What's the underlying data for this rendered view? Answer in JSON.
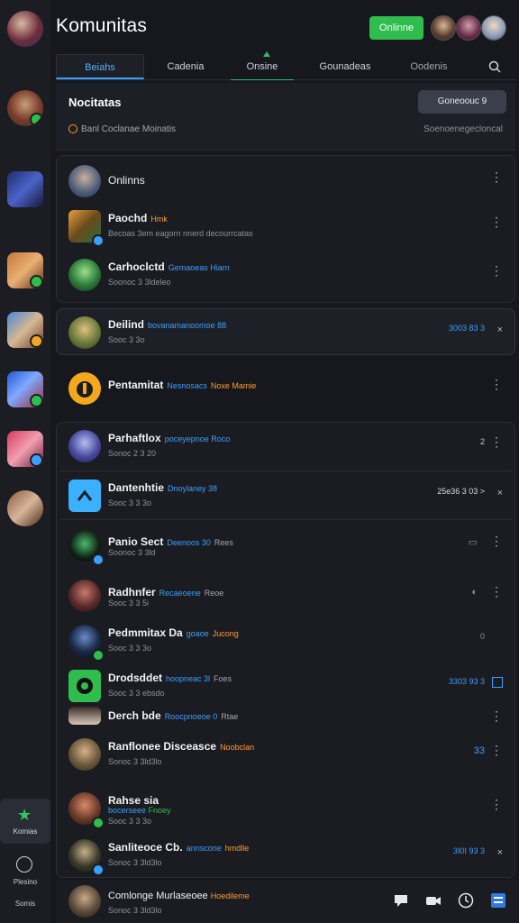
{
  "header": {
    "title": "Komunitas",
    "online_button": "Onlinne"
  },
  "tabs": [
    "Beiahs",
    "Cadenia",
    "Onsine",
    "Gounadeas",
    "Oodenis"
  ],
  "panel": {
    "title": "Nocitatas",
    "button": "Goneoouc 9",
    "subtitle": "Banl Coclanae Moinatis",
    "right_text": "Soenoenegecloncal"
  },
  "rows": [
    {
      "name": "Onlinns",
      "tag": "",
      "sub": "",
      "meta": ""
    },
    {
      "name": "Paochd",
      "tag": "Hmk",
      "sub": "Becoas 3em eagorn nnerd decourrcatas",
      "meta": ""
    },
    {
      "name": "Carhoclctd",
      "tag": "Gemaoeas Hiarn",
      "sub": "Soonoc 3 3ldeleo",
      "meta": ""
    },
    {
      "name": "Deilind",
      "tag": "bovanamanoomoe 88",
      "sub": "Sooc 3 3o",
      "meta": "3003 83 3"
    },
    {
      "name": "Pentamitat",
      "tag": "Nesnosacs",
      "tag2": "Noxe Mamie",
      "sub": "",
      "meta": ""
    },
    {
      "name": "Parhaftlox",
      "tag": "poceyepnoe Roco",
      "sub": "Sonoc 2 3 20",
      "meta": "2"
    },
    {
      "name": "Dantenhtie",
      "tag": "Dnoylaney 38",
      "sub": "Sooc 3 3 3o",
      "meta": "25e36 3 03 >"
    },
    {
      "name": "Panio Sect",
      "tag": "Deenoos 30",
      "tag2": "Rees",
      "sub": "Soonoc 3 3ld",
      "meta": ""
    },
    {
      "name": "Radhnfer",
      "tag": "Recaeoene",
      "tag2": "Reoe",
      "sub": "Sooc 3 3 5i",
      "meta": ""
    },
    {
      "name": "Pedmmitax Da",
      "tag": "goaoe",
      "tag2": "Jucong",
      "sub": "Sooc 3 3 3o",
      "meta": "0"
    },
    {
      "name": "Drodsddet",
      "tag": "hoopneac 3l",
      "tag2": "Foes",
      "sub": "Sooc 3 3 ebsdo",
      "meta": "3303 93 3"
    },
    {
      "name": "Derch bde",
      "tag": "Roocpnoeoe 0",
      "tag2": "Rtae",
      "sub": "",
      "meta": ""
    },
    {
      "name": "Ranflonee Disceasce",
      "tag": "Noobclan",
      "sub": "Sonoc 3 3ld3lo",
      "meta": "33"
    },
    {
      "name": "Rahse sia",
      "tag": "bocerseee",
      "tag2": "Fnoey",
      "sub": "Sooc 3 3 3o",
      "meta": ""
    },
    {
      "name": "Sanliteoce Cb.",
      "tag": "annscone",
      "tag2": "hmdlle",
      "sub": "Sonoc 3 3ld3lo",
      "meta": "3I0I 93 3"
    }
  ],
  "bottom_row": {
    "name": "Comlonge Murlaseoee",
    "tag": "Hoedileme",
    "sub": "Sonoc 3 3ld3lo"
  },
  "sidebar": {
    "community_label": "Komias",
    "explore_label": "Plesino",
    "extra_label": "Somis"
  },
  "colors": {
    "accent_blue": "#3aa0ff",
    "green": "#2fbe4e",
    "orange": "#ff9a2e"
  }
}
